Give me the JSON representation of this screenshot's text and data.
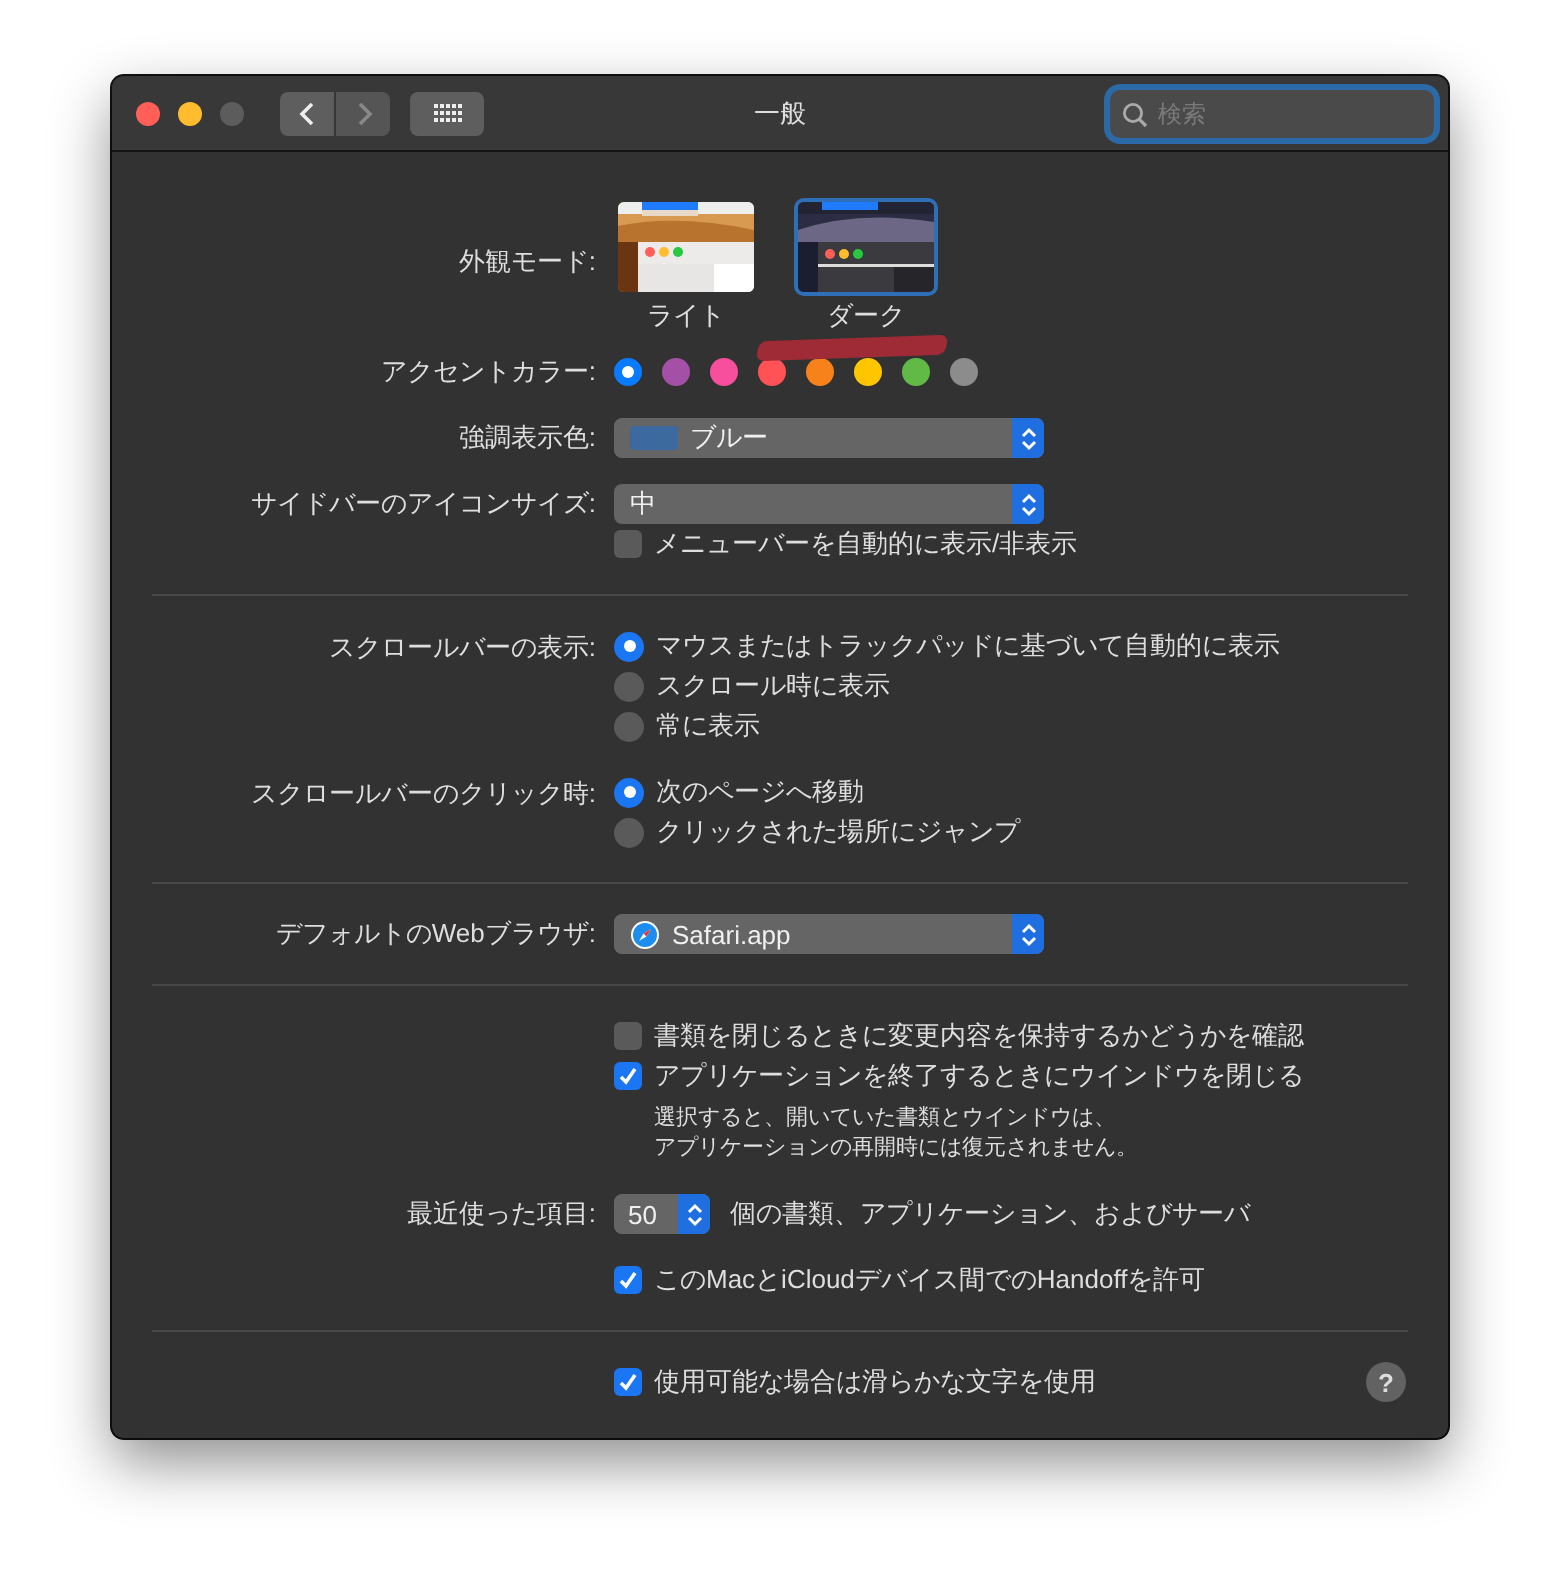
{
  "window": {
    "title": "一般",
    "search": {
      "placeholder": "検索"
    }
  },
  "sections": [
    {
      "rows": [
        {
          "kind": "appearance",
          "label": "外観モード:",
          "options": [
            {
              "label": "ライト",
              "selected": false,
              "marked": false
            },
            {
              "label": "ダーク",
              "selected": true,
              "marked": true
            }
          ]
        },
        {
          "kind": "swatches",
          "label": "アクセントカラー:",
          "colors": [
            {
              "color": "#0a7aff",
              "selected": true
            },
            {
              "color": "#a550a7",
              "selected": false
            },
            {
              "color": "#f74f9e",
              "selected": false
            },
            {
              "color": "#ff5257",
              "selected": false
            },
            {
              "color": "#f7821b",
              "selected": false
            },
            {
              "color": "#ffc600",
              "selected": false
            },
            {
              "color": "#62ba46",
              "selected": false
            },
            {
              "color": "#8c8c8c",
              "selected": false
            }
          ]
        },
        {
          "kind": "popup",
          "label": "強調表示色:",
          "value": "ブルー"
        },
        {
          "kind": "popup",
          "label": "サイドバーのアイコンサイズ:",
          "value": "中"
        },
        {
          "kind": "checkbox",
          "text": "メニューバーを自動的に表示/非表示",
          "checked": false
        }
      ]
    },
    {
      "rows": [
        {
          "kind": "radios",
          "label": "スクロールバーの表示:",
          "options": [
            {
              "text": "マウスまたはトラックパッドに基づいて自動的に表示",
              "selected": true
            },
            {
              "text": "スクロール時に表示",
              "selected": false
            },
            {
              "text": "常に表示",
              "selected": false
            }
          ]
        },
        {
          "kind": "radios",
          "label": "スクロールバーのクリック時:",
          "options": [
            {
              "text": "次のページへ移動",
              "selected": true
            },
            {
              "text": "クリックされた場所にジャンプ",
              "selected": false
            }
          ]
        }
      ]
    },
    {
      "rows": [
        {
          "kind": "popup",
          "label": "デフォルトのWebブラウザ:",
          "value": "Safari.app"
        }
      ]
    },
    {
      "rows": [
        {
          "kind": "checkbox",
          "text": "書類を閉じるときに変更内容を保持するかどうかを確認",
          "checked": false
        },
        {
          "kind": "checkbox",
          "text": "アプリケーションを終了するときにウインドウを閉じる",
          "checked": true
        },
        {
          "kind": "note",
          "lines": [
            "選択すると、開いていた書類とウインドウは、",
            "アプリケーションの再開時には復元されません。"
          ]
        },
        {
          "kind": "stepper",
          "label": "最近使った項目:",
          "value": "50",
          "suffix": "個の書類、アプリケーション、およびサーバ"
        },
        {
          "kind": "checkbox",
          "text": "このMacとiCloudデバイス間でのHandoffを許可",
          "checked": true
        }
      ]
    },
    {
      "rows": [
        {
          "kind": "checkbox",
          "text": "使用可能な場合は滑らかな文字を使用",
          "checked": true
        }
      ]
    }
  ],
  "help_button": "?"
}
